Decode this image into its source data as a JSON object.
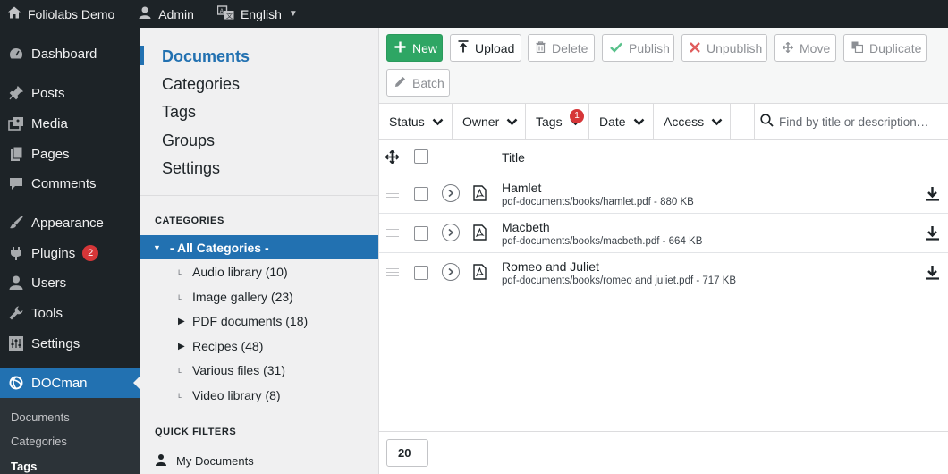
{
  "adminbar": {
    "site_name": "Foliolabs Demo",
    "user": "Admin",
    "language": "English"
  },
  "wp_menu": {
    "items": [
      {
        "label": "Dashboard",
        "icon": "dashboard-icon"
      },
      {
        "label": "Posts",
        "icon": "pin-icon"
      },
      {
        "label": "Media",
        "icon": "media-icon"
      },
      {
        "label": "Pages",
        "icon": "pages-icon"
      },
      {
        "label": "Comments",
        "icon": "comment-icon"
      },
      {
        "label": "Appearance",
        "icon": "brush-icon"
      },
      {
        "label": "Plugins",
        "icon": "plugin-icon",
        "badge": "2"
      },
      {
        "label": "Users",
        "icon": "user-icon"
      },
      {
        "label": "Tools",
        "icon": "wrench-icon"
      },
      {
        "label": "Settings",
        "icon": "settings-icon"
      },
      {
        "label": "DOCman",
        "icon": "docman-icon"
      }
    ],
    "submenu": [
      "Documents",
      "Categories",
      "Tags"
    ]
  },
  "docman_nav": {
    "items": [
      "Documents",
      "Categories",
      "Tags",
      "Groups",
      "Settings"
    ]
  },
  "categories": {
    "title": "CATEGORIES",
    "all_label": "- All Categories -",
    "items": [
      {
        "label": "Audio library (10)"
      },
      {
        "label": "Image gallery (23)"
      },
      {
        "label": "PDF documents (18)"
      },
      {
        "label": "Recipes (48)"
      },
      {
        "label": "Various files (31)"
      },
      {
        "label": "Video library (8)"
      }
    ]
  },
  "quick_filters": {
    "title": "QUICK FILTERS",
    "my_documents": "My Documents"
  },
  "toolbar": {
    "new": "New",
    "upload": "Upload",
    "delete": "Delete",
    "publish": "Publish",
    "unpublish": "Unpublish",
    "move": "Move",
    "duplicate": "Duplicate",
    "batch": "Batch"
  },
  "filters": {
    "status": "Status",
    "owner": "Owner",
    "tags": "Tags",
    "tags_badge": "1",
    "date": "Date",
    "access": "Access",
    "search_placeholder": "Find by title or description…"
  },
  "table": {
    "title_header": "Title",
    "rows": [
      {
        "title": "Hamlet",
        "path": "pdf-documents/books/hamlet.pdf - 880 KB"
      },
      {
        "title": "Macbeth",
        "path": "pdf-documents/books/macbeth.pdf - 664 KB"
      },
      {
        "title": "Romeo and Juliet",
        "path": "pdf-documents/books/romeo and juliet.pdf - 717 KB"
      }
    ]
  },
  "pagination": {
    "per_page": "20"
  },
  "colors": {
    "admin_bar": "#1d2327",
    "accent": "#2271b1",
    "new_button": "#2ea664",
    "badge": "#d63638"
  }
}
